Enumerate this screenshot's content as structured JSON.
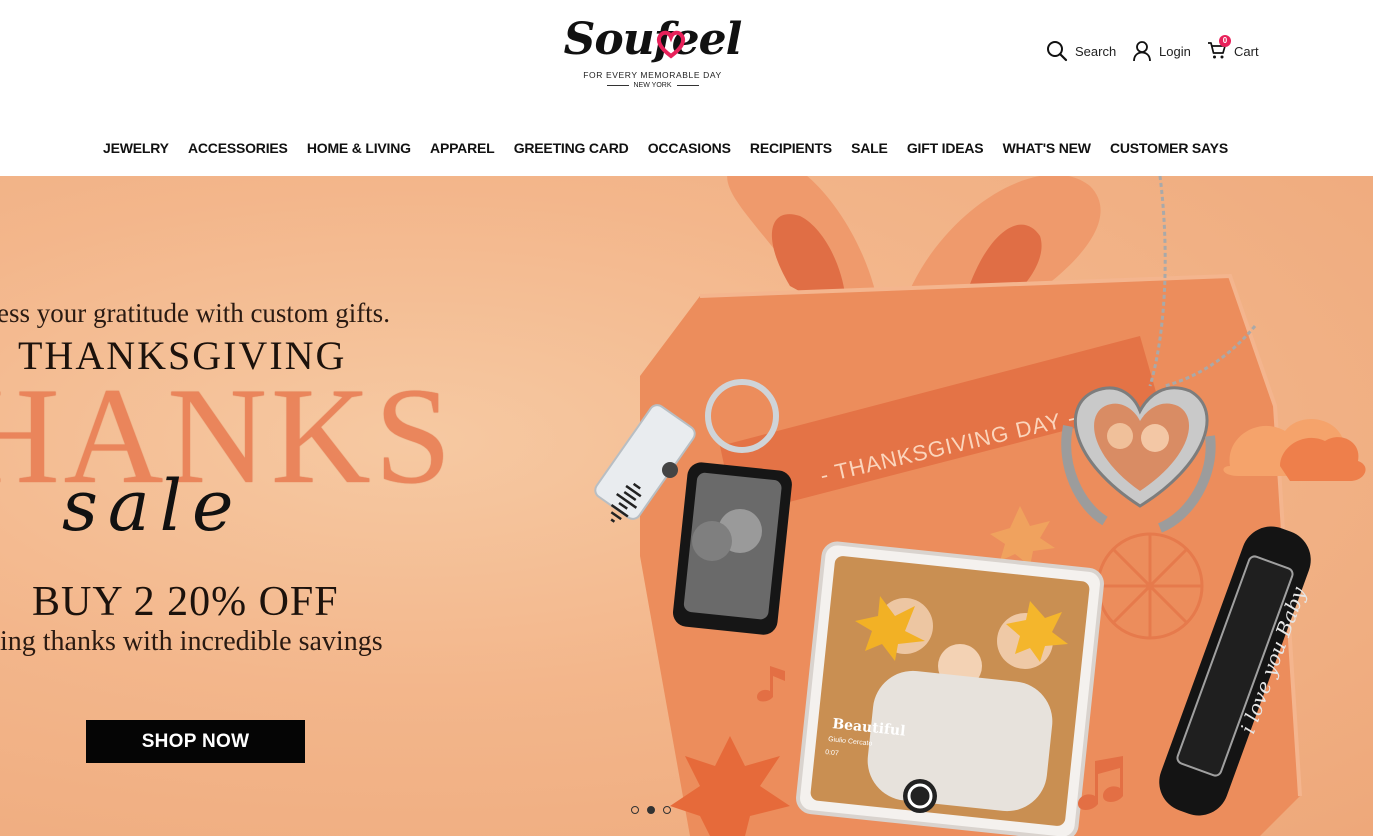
{
  "brand": {
    "name": "Soufeel",
    "tagline": "FOR EVERY MEMORABLE DAY",
    "location": "NEW YORK"
  },
  "header_actions": {
    "search_label": "Search",
    "login_label": "Login",
    "cart_label": "Cart",
    "cart_count": "0"
  },
  "nav": {
    "items": [
      {
        "label": "JEWELRY"
      },
      {
        "label": "ACCESSORIES"
      },
      {
        "label": "HOME & LIVING"
      },
      {
        "label": "APPAREL"
      },
      {
        "label": "GREETING CARD"
      },
      {
        "label": "OCCASIONS"
      },
      {
        "label": "RECIPIENTS"
      },
      {
        "label": "SALE"
      },
      {
        "label": "GIFT IDEAS"
      },
      {
        "label": "WHAT'S NEW"
      },
      {
        "label": "CUSTOMER SAYS"
      }
    ]
  },
  "hero": {
    "line1": "ress your gratitude with custom gifts.",
    "line2": "THANKSGIVING",
    "big_word": "HANKS",
    "script_word": "sale",
    "offer": "BUY 2 20% OFF",
    "subline": "ving thanks with incredible savings",
    "cta_label": "SHOP NOW",
    "ribbon_text": "- THANKSGIVING DAY -",
    "plaque_title": "Beautiful",
    "plaque_artist": "Giulio Cercato",
    "plaque_time": "0:07",
    "bracelet_text": "i love you  Baby",
    "colors": {
      "background": "#f3b68b",
      "box": "#ec8d5c",
      "accent_big_text": "#e97f55",
      "cta": "#050505"
    },
    "slides_total": 3,
    "active_slide": 2
  }
}
